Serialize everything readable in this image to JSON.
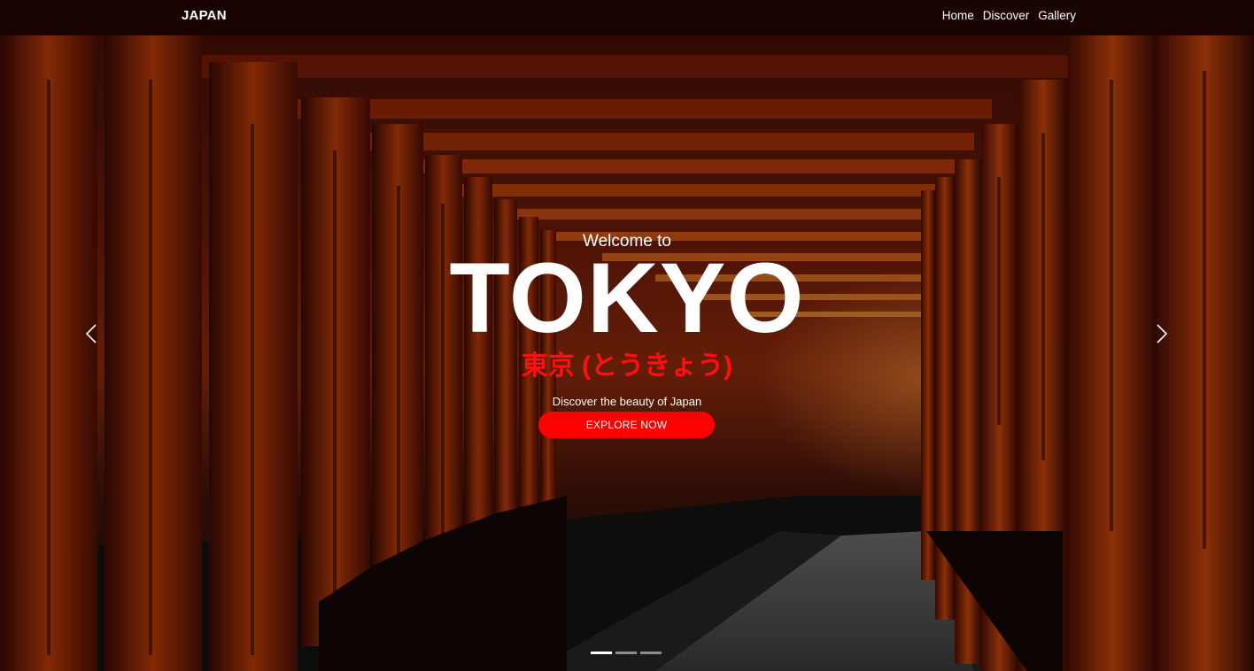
{
  "navbar": {
    "brand": "JAPAN",
    "links": [
      "Home",
      "Discover",
      "Gallery"
    ]
  },
  "hero": {
    "welcome": "Welcome to",
    "city": "TOKYO",
    "kanji": "東京 (とうきょう)",
    "tagline": "Discover the beauty of Japan",
    "button_label": "EXPLORE NOW"
  },
  "carousel": {
    "prev_icon": "chevron-left-icon",
    "next_icon": "chevron-right-icon",
    "slide_count": 3,
    "active_slide": 1
  },
  "colors": {
    "accent": "#ff0000",
    "kanji": "#ff1010",
    "navbar_bg": "#140200"
  }
}
